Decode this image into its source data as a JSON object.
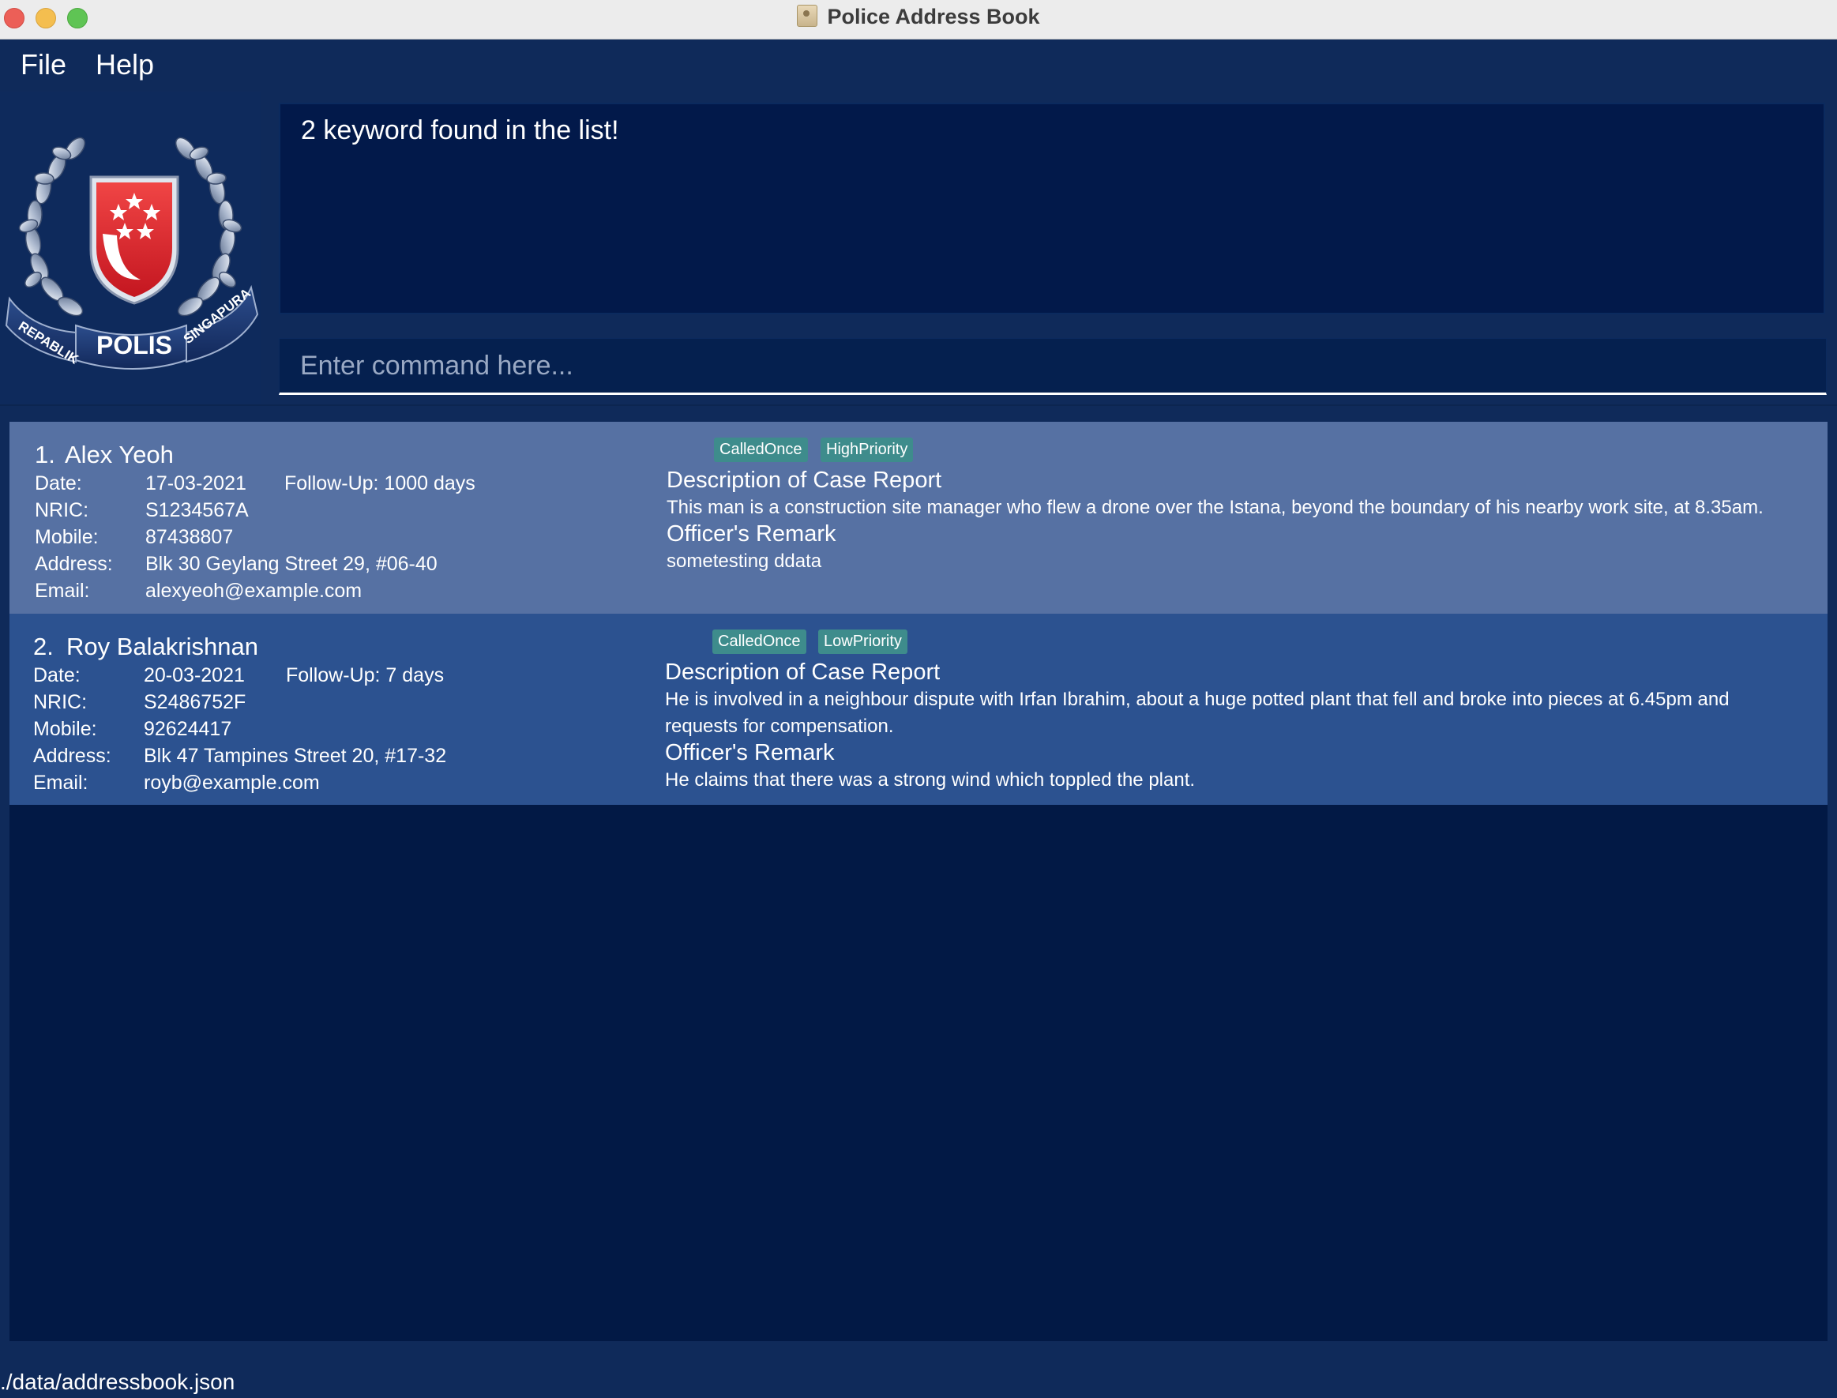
{
  "window": {
    "title": "Police Address Book"
  },
  "menu": {
    "file": "File",
    "help": "Help"
  },
  "logo": {
    "left_text": "REPABLIK",
    "center_text": "POLIS",
    "right_text": "SINGAPURA"
  },
  "result": {
    "text": "2 keyword found in the list!"
  },
  "command": {
    "placeholder": "Enter command here..."
  },
  "labels": {
    "date": "Date:",
    "nric": "NRIC:",
    "mobile": "Mobile:",
    "address": "Address:",
    "email": "Email:"
  },
  "persons": [
    {
      "index": "1.",
      "name": "Alex Yeoh",
      "date": "17-03-2021",
      "follow_up": "Follow-Up: 1000 days",
      "nric": "S1234567A",
      "mobile": "87438807",
      "address": "Blk 30 Geylang Street 29, #06-40",
      "email": "alexyeoh@example.com",
      "tags": [
        "CalledOnce",
        "HighPriority"
      ],
      "description_title": "Description of Case Report",
      "description": "This man is a construction site manager who flew a drone over the Istana, beyond the boundary of his nearby work site, at 8.35am.",
      "remark_title": "Officer's Remark",
      "remark": "sometesting ddata"
    },
    {
      "index": "2.",
      "name": "Roy Balakrishnan",
      "date": "20-03-2021",
      "follow_up": "Follow-Up: 7 days",
      "nric": "S2486752F",
      "mobile": "92624417",
      "address": "Blk 47 Tampines Street 20, #17-32",
      "email": "royb@example.com",
      "tags": [
        "CalledOnce",
        "LowPriority"
      ],
      "description_title": "Description of Case Report",
      "description_line1": "He is involved in a neighbour dispute with Irfan Ibrahim, about a huge potted plant that fell and broke into pieces at 6.45pm and",
      "description_line2": "requests for compensation.",
      "remark_title": "Officer's Remark",
      "remark": "He claims that there was a strong wind which toppled the plant."
    }
  ],
  "status": {
    "path": "./data/addressbook.json"
  },
  "colors": {
    "background": "#0f2a5a",
    "card_selected": "#5671a3",
    "card": "#2c5290",
    "tag": "#3e8c8c"
  }
}
